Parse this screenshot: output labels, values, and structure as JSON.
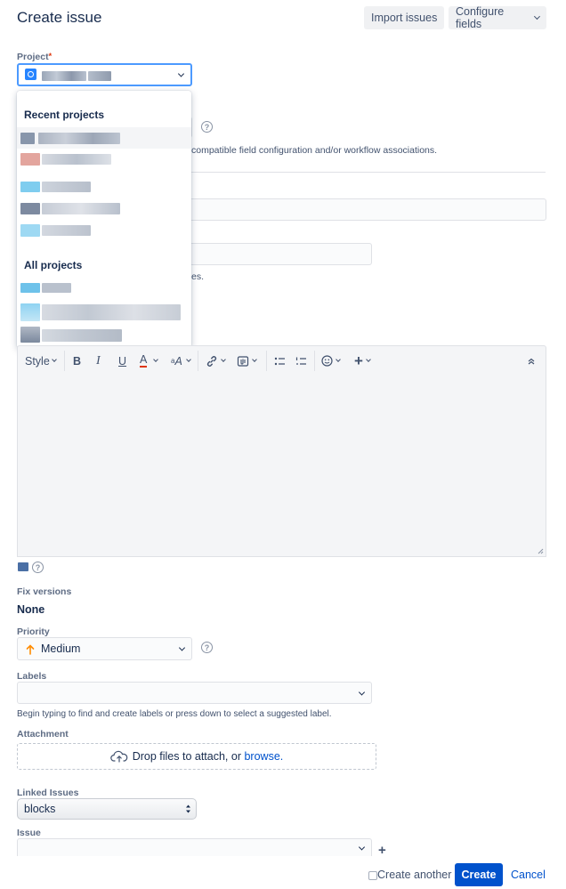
{
  "header": {
    "title": "Create issue",
    "import_label": "Import issues",
    "configure_label": "Configure fields"
  },
  "project": {
    "label": "Project",
    "required_mark": "*"
  },
  "dropdown": {
    "recent_heading": "Recent projects",
    "all_heading": "All projects"
  },
  "partially_visible": {
    "issue_type_note": "compatible field configuration and/or workflow associations.",
    "summary_hint_tail": "es."
  },
  "toolbar": {
    "style_label": "Style",
    "bold": "B",
    "italic": "I",
    "underline": "U",
    "text_color": "A"
  },
  "fix_versions": {
    "label": "Fix versions",
    "value": "None"
  },
  "priority": {
    "label": "Priority",
    "value": "Medium"
  },
  "labels": {
    "label": "Labels",
    "hint": "Begin typing to find and create labels or press down to select a suggested label."
  },
  "attachment": {
    "label": "Attachment",
    "drop_text": "Drop files to attach, or",
    "browse_link": "browse."
  },
  "linked_issues": {
    "label": "Linked Issues",
    "value": "blocks"
  },
  "issue": {
    "label": "Issue"
  },
  "footer": {
    "create_another": "Create another",
    "create_label": "Create",
    "cancel_label": "Cancel"
  },
  "colors": {
    "primary": "#0052cc",
    "focus": "#4c9aff",
    "required": "#de350b",
    "priority_medium": "#ff8b00"
  }
}
